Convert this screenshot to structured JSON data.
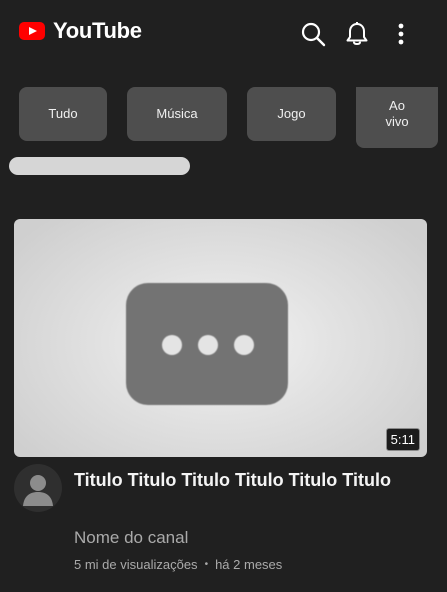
{
  "header": {
    "logo_text": "YouTube",
    "brand_color": "#ff0000",
    "icons": [
      "search-icon",
      "bell-icon",
      "more-vert-icon"
    ]
  },
  "chips": [
    {
      "label": "Tudo"
    },
    {
      "label": "Música"
    },
    {
      "label": "Jogo"
    },
    {
      "label": "Ao vivo"
    }
  ],
  "video": {
    "duration": "5:11",
    "title": "Titulo Titulo Titulo Titulo Titulo Titulo",
    "channel": "Nome do canal",
    "views": "5 mi de visualizações",
    "separator": "•",
    "age": "há 2 meses"
  }
}
